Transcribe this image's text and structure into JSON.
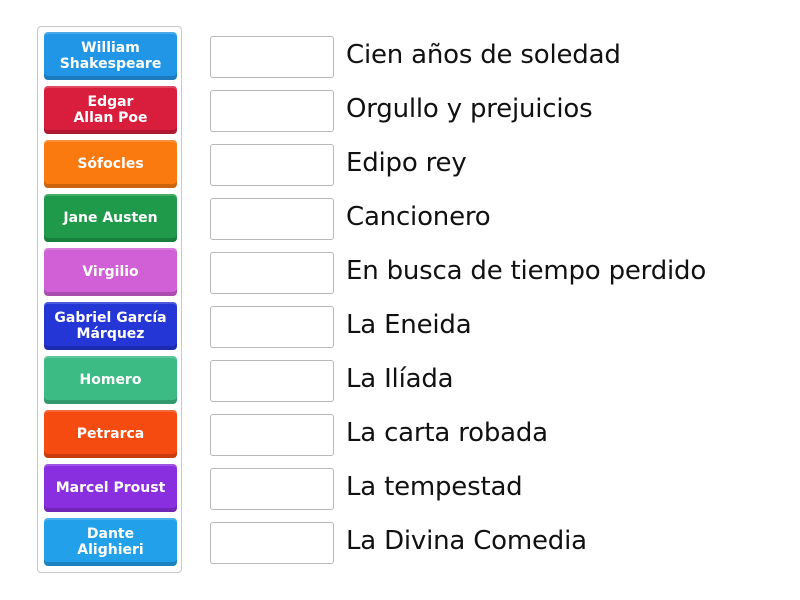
{
  "authors": [
    {
      "name": "William Shakespeare",
      "lines": [
        "William",
        "Shakespeare"
      ],
      "color": "#2196e6"
    },
    {
      "name": "Edgar Allan Poe",
      "lines": [
        "Edgar",
        "Allan Poe"
      ],
      "color": "#d81e3c"
    },
    {
      "name": "Sófocles",
      "lines": [
        "Sófocles"
      ],
      "color": "#fb7a10"
    },
    {
      "name": "Jane Austen",
      "lines": [
        "Jane Austen"
      ],
      "color": "#1e9a4a"
    },
    {
      "name": "Virgilio",
      "lines": [
        "Virgilio"
      ],
      "color": "#d15fd6"
    },
    {
      "name": "Gabriel García Márquez",
      "lines": [
        "Gabriel García",
        "Márquez"
      ],
      "color": "#2436d6"
    },
    {
      "name": "Homero",
      "lines": [
        "Homero"
      ],
      "color": "#3dbb85"
    },
    {
      "name": "Petrarca",
      "lines": [
        "Petrarca"
      ],
      "color": "#f54a10"
    },
    {
      "name": "Marcel Proust",
      "lines": [
        "Marcel Proust"
      ],
      "color": "#8a2fe0"
    },
    {
      "name": "Dante Alighieri",
      "lines": [
        "Dante",
        "Alighieri"
      ],
      "color": "#22a0ea"
    }
  ],
  "works": [
    {
      "title": "Cien años de soledad",
      "answer": ""
    },
    {
      "title": "Orgullo y prejuicios",
      "answer": ""
    },
    {
      "title": "Edipo rey",
      "answer": ""
    },
    {
      "title": "Cancionero",
      "answer": ""
    },
    {
      "title": "En busca de tiempo perdido",
      "answer": ""
    },
    {
      "title": "La Eneida",
      "answer": ""
    },
    {
      "title": "La Ilíada",
      "answer": ""
    },
    {
      "title": "La carta robada",
      "answer": ""
    },
    {
      "title": "La tempestad",
      "answer": ""
    },
    {
      "title": "La Divina Comedia",
      "answer": ""
    }
  ]
}
